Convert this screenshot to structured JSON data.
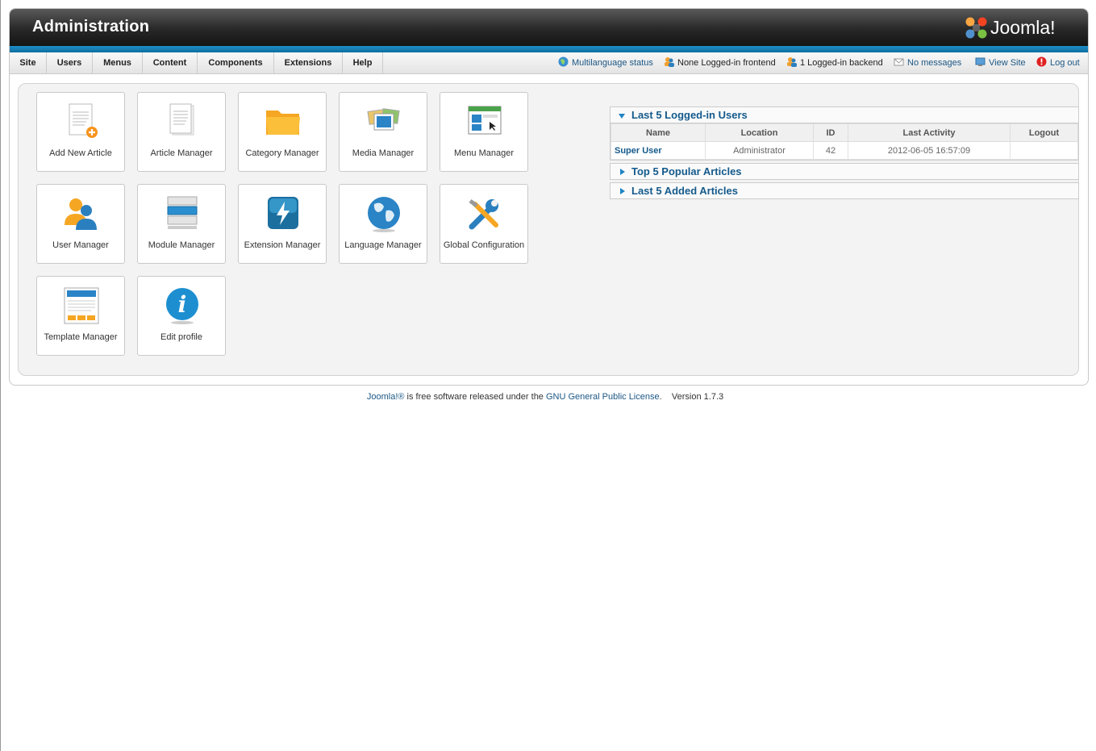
{
  "header": {
    "title": "Administration",
    "logo_text": "Joomla!"
  },
  "menu": [
    {
      "label": "Site"
    },
    {
      "label": "Users"
    },
    {
      "label": "Menus"
    },
    {
      "label": "Content"
    },
    {
      "label": "Components"
    },
    {
      "label": "Extensions"
    },
    {
      "label": "Help"
    }
  ],
  "status": {
    "multilanguage": "Multilanguage status",
    "frontend": "None Logged-in frontend",
    "backend": "1 Logged-in backend",
    "messages": "No messages",
    "view_site": "View Site",
    "logout": "Log out"
  },
  "quickicons": [
    {
      "label": "Add New Article",
      "icon": "add-article-icon"
    },
    {
      "label": "Article Manager",
      "icon": "article-icon"
    },
    {
      "label": "Category Manager",
      "icon": "folder-icon"
    },
    {
      "label": "Media Manager",
      "icon": "media-icon"
    },
    {
      "label": "Menu Manager",
      "icon": "menu-icon"
    },
    {
      "label": "User Manager",
      "icon": "users-icon"
    },
    {
      "label": "Module Manager",
      "icon": "module-icon"
    },
    {
      "label": "Extension Manager",
      "icon": "extension-icon"
    },
    {
      "label": "Language Manager",
      "icon": "globe-icon"
    },
    {
      "label": "Global Configuration",
      "icon": "tools-icon"
    },
    {
      "label": "Template Manager",
      "icon": "template-icon"
    },
    {
      "label": "Edit profile",
      "icon": "info-icon"
    }
  ],
  "modules": {
    "logged": {
      "title": "Last 5 Logged-in Users",
      "columns": [
        "Name",
        "Location",
        "ID",
        "Last Activity",
        "Logout"
      ],
      "rows": [
        {
          "name": "Super User",
          "location": "Administrator",
          "id": "42",
          "last_activity": "2012-06-05 16:57:09",
          "logout": ""
        }
      ]
    },
    "popular": {
      "title": "Top 5 Popular Articles"
    },
    "added": {
      "title": "Last 5 Added Articles"
    }
  },
  "footer": {
    "joomla_link": "Joomla!®",
    "text": " is free software released under the ",
    "license_link": "GNU General Public License",
    "period": ".",
    "version": "Version 1.7.3"
  }
}
